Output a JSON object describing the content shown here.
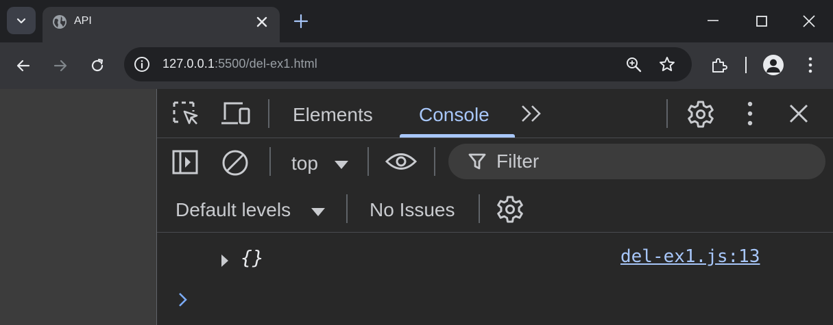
{
  "tabstrip": {
    "tab_title": "API"
  },
  "toolbar": {
    "url_host": "127.0.0.1",
    "url_rest": ":5500/del-ex1.html"
  },
  "devtools": {
    "tabs": [
      "Elements",
      "Console"
    ],
    "active_tab": "Console",
    "console": {
      "context": "top",
      "filter_placeholder": "Filter",
      "levels": "Default levels",
      "issues": "No Issues",
      "log": [
        {
          "value": "{}",
          "source": "del-ex1.js:13"
        }
      ]
    }
  },
  "colors": {
    "accent": "#a8c7fa",
    "chrome_bg": "#202124",
    "toolbar_bg": "#35363a",
    "devtools_bg": "#282828"
  },
  "icons": [
    "tab-search-icon",
    "globe-icon",
    "close-icon",
    "plus-icon",
    "minimize-icon",
    "maximize-icon",
    "back-arrow-icon",
    "forward-arrow-icon",
    "reload-icon",
    "info-icon",
    "zoom-icon",
    "star-icon",
    "extensions-icon",
    "profile-icon",
    "kebab-menu-icon",
    "inspect-icon",
    "device-toggle-icon",
    "more-tabs-icon",
    "settings-gear-icon",
    "sidebar-icon",
    "clear-console-icon",
    "eye-icon",
    "filter-icon"
  ]
}
